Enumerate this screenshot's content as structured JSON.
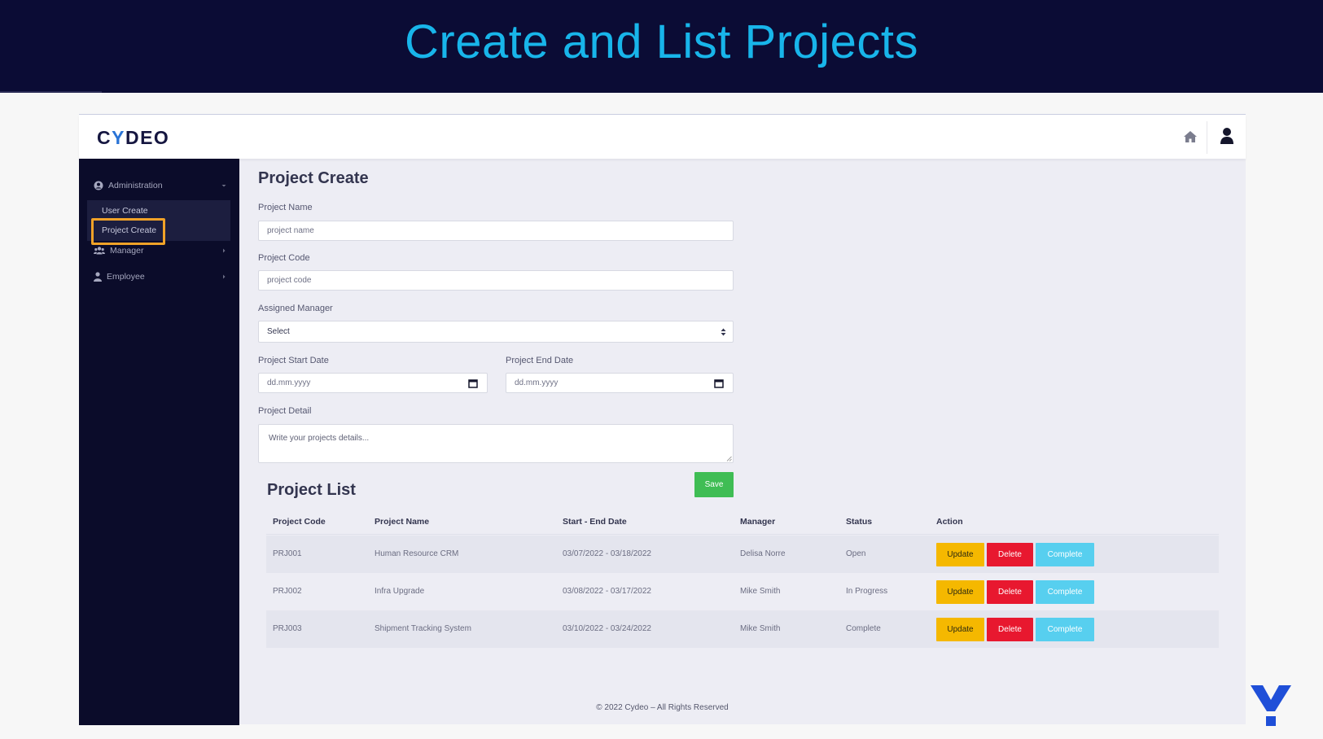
{
  "slide": {
    "title": "Create and List Projects"
  },
  "app": {
    "logo": {
      "pre": "C",
      "y": "Y",
      "post": "DEO"
    },
    "icons": {
      "home": "home-icon",
      "user": "user-icon"
    }
  },
  "sidebar": {
    "administration": "Administration",
    "sub_items": [
      "User Create",
      "Project Create"
    ],
    "manager": "Manager",
    "employee": "Employee"
  },
  "form": {
    "title": "Project Create",
    "project_name_label": "Project Name",
    "project_name_placeholder": "project name",
    "project_code_label": "Project Code",
    "project_code_placeholder": "project code",
    "manager_label": "Assigned Manager",
    "manager_selected": "Select",
    "start_label": "Project Start Date",
    "start_value": "dd.mm.yyyy",
    "end_label": "Project End Date",
    "end_value": "dd.mm.yyyy",
    "detail_label": "Project Detail",
    "detail_placeholder": "Write your projects details...",
    "save_label": "Save"
  },
  "list": {
    "title": "Project List",
    "columns": [
      "Project Code",
      "Project Name",
      "Start - End Date",
      "Manager",
      "Status",
      "Action"
    ],
    "rows": [
      {
        "code": "PRJ001",
        "name": "Human Resource CRM",
        "dates": "03/07/2022 - 03/18/2022",
        "manager": "Delisa Norre",
        "status": "Open"
      },
      {
        "code": "PRJ002",
        "name": "Infra Upgrade",
        "dates": "03/08/2022 - 03/17/2022",
        "manager": "Mike Smith",
        "status": "In Progress"
      },
      {
        "code": "PRJ003",
        "name": "Shipment Tracking System",
        "dates": "03/10/2022 - 03/24/2022",
        "manager": "Mike Smith",
        "status": "Complete"
      }
    ],
    "actions": {
      "update": "Update",
      "delete": "Delete",
      "complete": "Complete"
    }
  },
  "footer": "© 2022 Cydeo – All Rights Reserved",
  "colors": {
    "header_bg": "#0b0c35",
    "title": "#18b5ea",
    "sidebar_bg": "#0b0c2a",
    "save": "#3fbd54",
    "update": "#f5b800",
    "delete": "#e8182f",
    "complete": "#57cfef",
    "highlight": "#f0a228"
  }
}
